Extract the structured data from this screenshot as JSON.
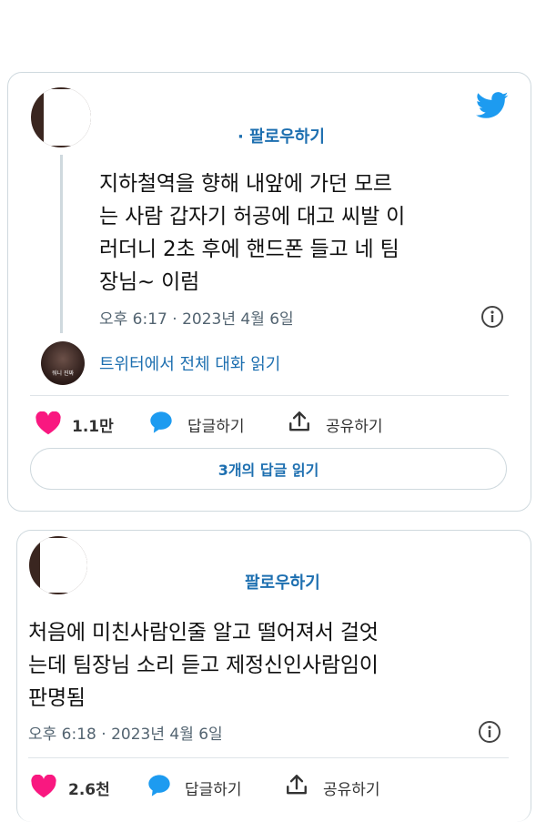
{
  "colors": {
    "accent": "#1d9bf0",
    "like": "#f91880",
    "text": "#0f1419",
    "muted": "#536471"
  },
  "tweet1": {
    "follow_label": "· 팔로우하기",
    "text_lines": [
      "지하철역을 향해 내앞에 가던 모르",
      "는 사람 갑자기 허공에 대고 씨발 이",
      "러더니 2초 후에 핸드폰 들고 네 팀",
      "장님~ 이럼"
    ],
    "timestamp": "오후 6:17 · 2023년 4월 6일",
    "read_thread_label": "트위터에서 전체 대화 읽기",
    "thread_avatar_text": "워니 진짜",
    "likes": "1.1만",
    "reply_label": "답글하기",
    "share_label": "공유하기",
    "read_replies_label": "3개의 답글 읽기",
    "icons": {
      "logo": "twitter-bird-icon",
      "info": "info-icon",
      "like": "heart-icon",
      "reply": "speech-bubble-icon",
      "share": "share-icon"
    }
  },
  "tweet2": {
    "follow_label": "팔로우하기",
    "text_lines": [
      "처음에 미친사람인줄 알고 떨어져서 걸엇",
      "는데 팀장님 소리 듣고 제정신인사람임이",
      "판명됨"
    ],
    "timestamp": "오후 6:18 · 2023년 4월 6일",
    "likes": "2.6천",
    "reply_label": "답글하기",
    "share_label": "공유하기",
    "icons": {
      "info": "info-icon",
      "like": "heart-icon",
      "reply": "speech-bubble-icon",
      "share": "share-icon"
    }
  }
}
